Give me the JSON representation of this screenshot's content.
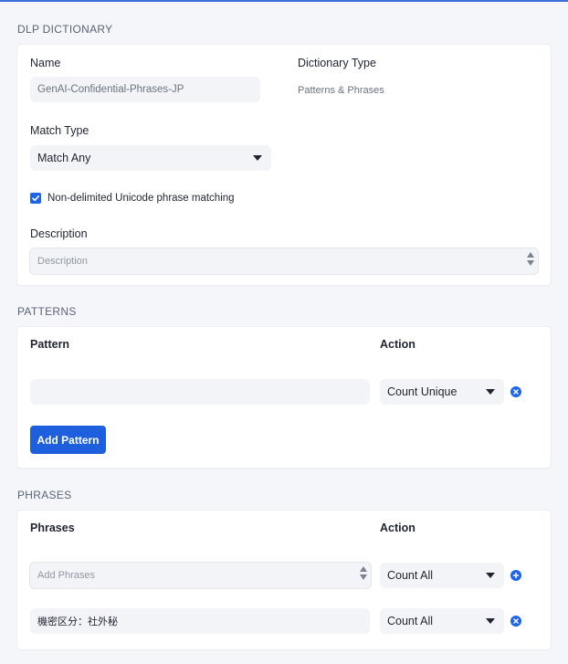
{
  "dlp": {
    "section_title": "DLP DICTIONARY",
    "name_label": "Name",
    "name_value": "GenAI-Confidential-Phrases-JP",
    "type_label": "Dictionary Type",
    "type_value": "Patterns & Phrases",
    "match_type_label": "Match Type",
    "match_type_value": "Match Any",
    "unicode_checkbox_label": "Non-delimited Unicode phrase matching",
    "unicode_checked": true,
    "description_label": "Description",
    "description_placeholder": "Description"
  },
  "patterns": {
    "section_title": "PATTERNS",
    "col_pattern": "Pattern",
    "col_action": "Action",
    "rows": [
      {
        "value": "",
        "action": "Count Unique"
      }
    ],
    "add_button": "Add Pattern"
  },
  "phrases": {
    "section_title": "PHRASES",
    "col_phrases": "Phrases",
    "col_action": "Action",
    "new_placeholder": "Add Phrases",
    "new_action": "Count All",
    "rows": [
      {
        "value": "機密区分：社外秘",
        "action": "Count All"
      }
    ]
  },
  "colors": {
    "accent": "#1e64e6",
    "top_line": "#3c6fd8",
    "background": "#f5f6fa"
  }
}
